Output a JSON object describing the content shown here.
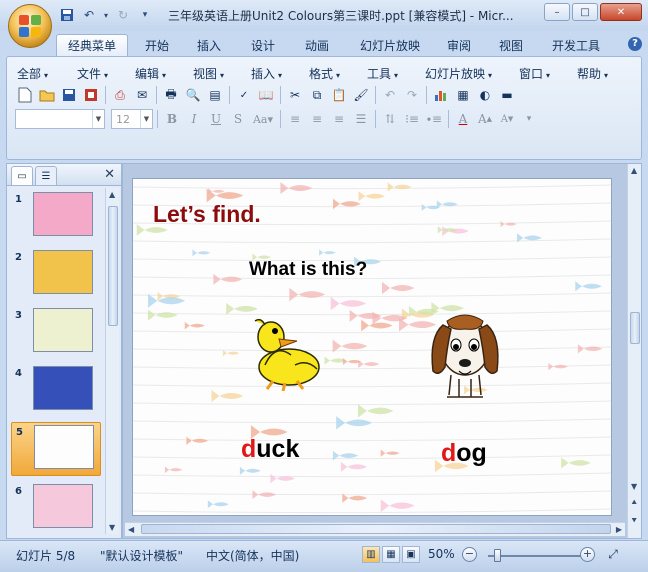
{
  "window": {
    "title": "三年级英语上册Unit2 Colours第三课时.ppt [兼容模式] - Micr...",
    "controls": [
      "–",
      "□",
      "✕"
    ]
  },
  "ribbon_tabs": [
    {
      "label": "经典菜单",
      "active": true
    },
    {
      "label": "开始"
    },
    {
      "label": "插入"
    },
    {
      "label": "设计"
    },
    {
      "label": "动画"
    },
    {
      "label": "幻灯片放映"
    },
    {
      "label": "审阅"
    },
    {
      "label": "视图"
    },
    {
      "label": "开发工具"
    }
  ],
  "menus": [
    "全部",
    "文件",
    "编辑",
    "视图",
    "插入",
    "格式",
    "工具",
    "幻灯片放映",
    "窗口",
    "帮助"
  ],
  "font_size": "12",
  "font_name": "",
  "slides": [
    {
      "num": "1",
      "bg": "#f3a9c7"
    },
    {
      "num": "2",
      "bg": "#f1c34a"
    },
    {
      "num": "3",
      "bg": "#eef1d0"
    },
    {
      "num": "4",
      "bg": "#3550b8"
    },
    {
      "num": "5",
      "bg": "#fdfdfd",
      "selected": true
    },
    {
      "num": "6",
      "bg": "#f6c8dc"
    }
  ],
  "slide": {
    "title": "Let’s find.",
    "question": "What is this?",
    "word1_first": "d",
    "word1_rest": "uck",
    "word2_first": "d",
    "word2_rest": "og",
    "accent_red": "#e01818",
    "title_color": "#8c0c0c"
  },
  "status": {
    "slide_info": "幻灯片 5/8",
    "template": "\"默认设计模板\"",
    "language": "中文(简体，中国)",
    "zoom": "50%"
  }
}
